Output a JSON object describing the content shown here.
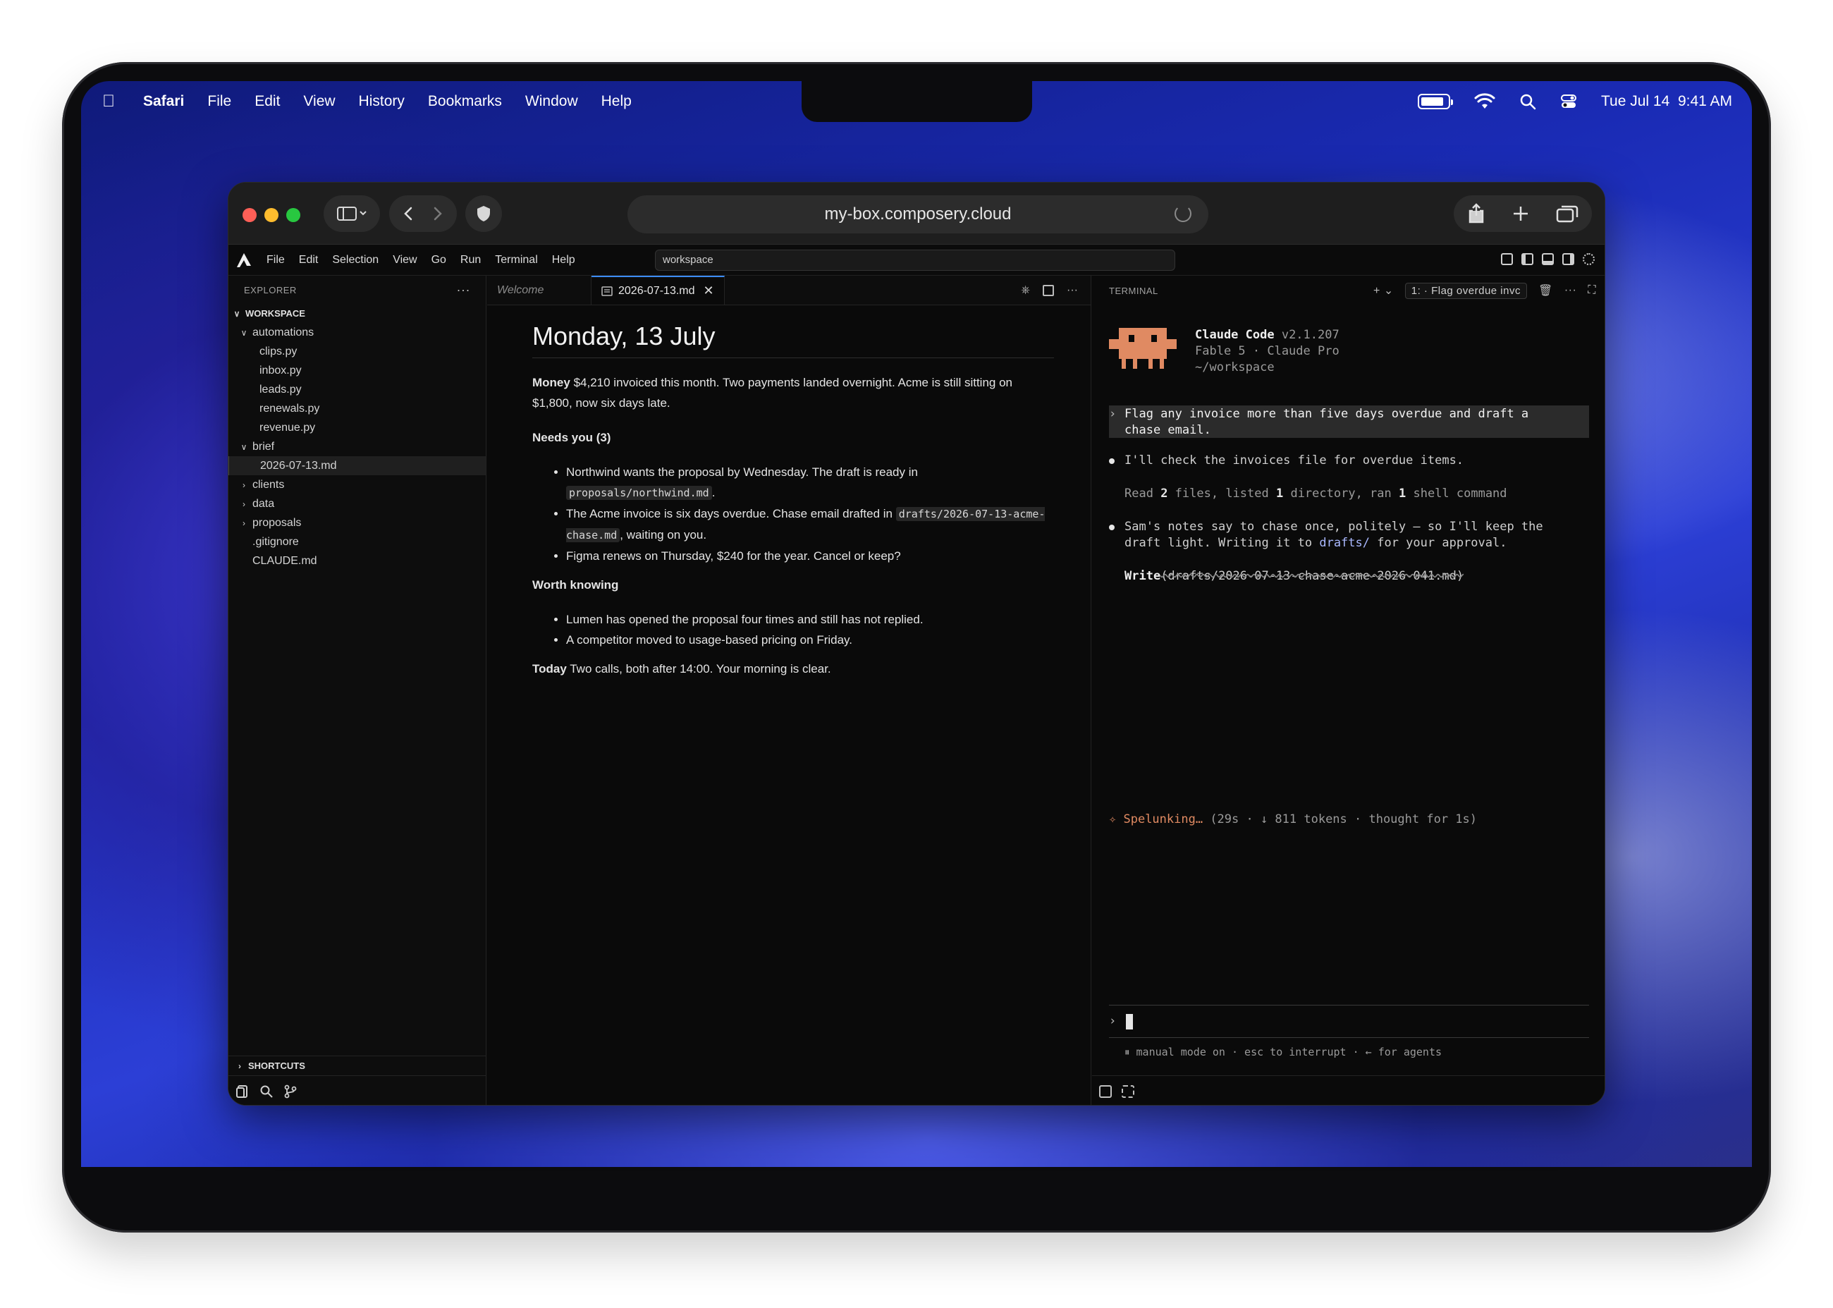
{
  "menubar": {
    "app": "Safari",
    "items": [
      "File",
      "Edit",
      "View",
      "History",
      "Bookmarks",
      "Window",
      "Help"
    ],
    "clock": "Tue Jul 14  9:41 AM",
    "battery_level": 0.85
  },
  "safari": {
    "url": "my-box.composery.cloud"
  },
  "vscode": {
    "menu": [
      "File",
      "Edit",
      "Selection",
      "View",
      "Go",
      "Run",
      "Terminal",
      "Help"
    ],
    "command_center": "workspace"
  },
  "explorer": {
    "title": "EXPLORER",
    "more": "···",
    "workspace": "WORKSPACE",
    "folder_automations": "automations",
    "automation_files": [
      "clips.py",
      "inbox.py",
      "leads.py",
      "renewals.py",
      "revenue.py"
    ],
    "folder_brief": "brief",
    "brief_file": "2026-07-13.md",
    "folders_collapsed": [
      "clients",
      "data",
      "proposals"
    ],
    "root_files": [
      ".gitignore",
      "CLAUDE.md"
    ],
    "shortcuts": "SHORTCUTS"
  },
  "editor": {
    "tab_welcome": "Welcome",
    "tab_active": "2026-07-13.md",
    "title": "Monday, 13 July",
    "money_label": "Money",
    "money_text": " $4,210 invoiced this month. Two payments landed overnight. Acme is still sitting on $1,800, now six days late.",
    "needs_heading": "Needs you (3)",
    "needs_1_text": "Northwind wants the proposal by Wednesday. The draft is ready in ",
    "needs_1_code": "proposals/northwind.md",
    "needs_1_end": ".",
    "needs_2_text": "The Acme invoice is six days overdue. Chase email drafted in ",
    "needs_2_code": "drafts/2026-07-13-acme-chase.md",
    "needs_2_end": ", waiting on you.",
    "needs_3": "Figma renews on Thursday, $240 for the year. Cancel or keep?",
    "worth_heading": "Worth knowing",
    "worth_1": "Lumen has opened the proposal four times and still has not replied.",
    "worth_2": "A competitor moved to usage-based pricing on Friday.",
    "today_label": "Today",
    "today_text": " Two calls, both after 14:00. Your morning is clear."
  },
  "terminal": {
    "title": "TERMINAL",
    "selector": "1: · Flag overdue invc",
    "app_name": "Claude Code",
    "version": " v2.1.207",
    "model_line": "Fable 5 · Claude Pro",
    "cwd": "~/workspace",
    "prompt_1": "Flag any invoice more than five days overdue and draft a",
    "prompt_2": "chase email.",
    "reply_1": "I'll check the invoices file for overdue items.",
    "tool_read_a": "Read ",
    "tool_read_n1": "2",
    "tool_read_b": " files, listed ",
    "tool_read_n2": "1",
    "tool_read_c": " directory, ran ",
    "tool_read_n3": "1",
    "tool_read_d": " shell command",
    "reply_2a": "Sam's notes say to chase once, politely — so I'll keep the",
    "reply_2b_pre": "draft light. Writing it to ",
    "reply_2b_link": "drafts/",
    "reply_2b_post": " for your approval.",
    "write_label": "Write",
    "write_path": "(drafts/2026-07-13-chase-acme-2026-041.md)",
    "status_spinner": "Spelunking…",
    "status_detail": " (29s · ↓ 811 tokens · thought for 1s)",
    "footer": "⏸ manual mode on · esc to interrupt · ← for agents",
    "accent": "#e08a62"
  }
}
